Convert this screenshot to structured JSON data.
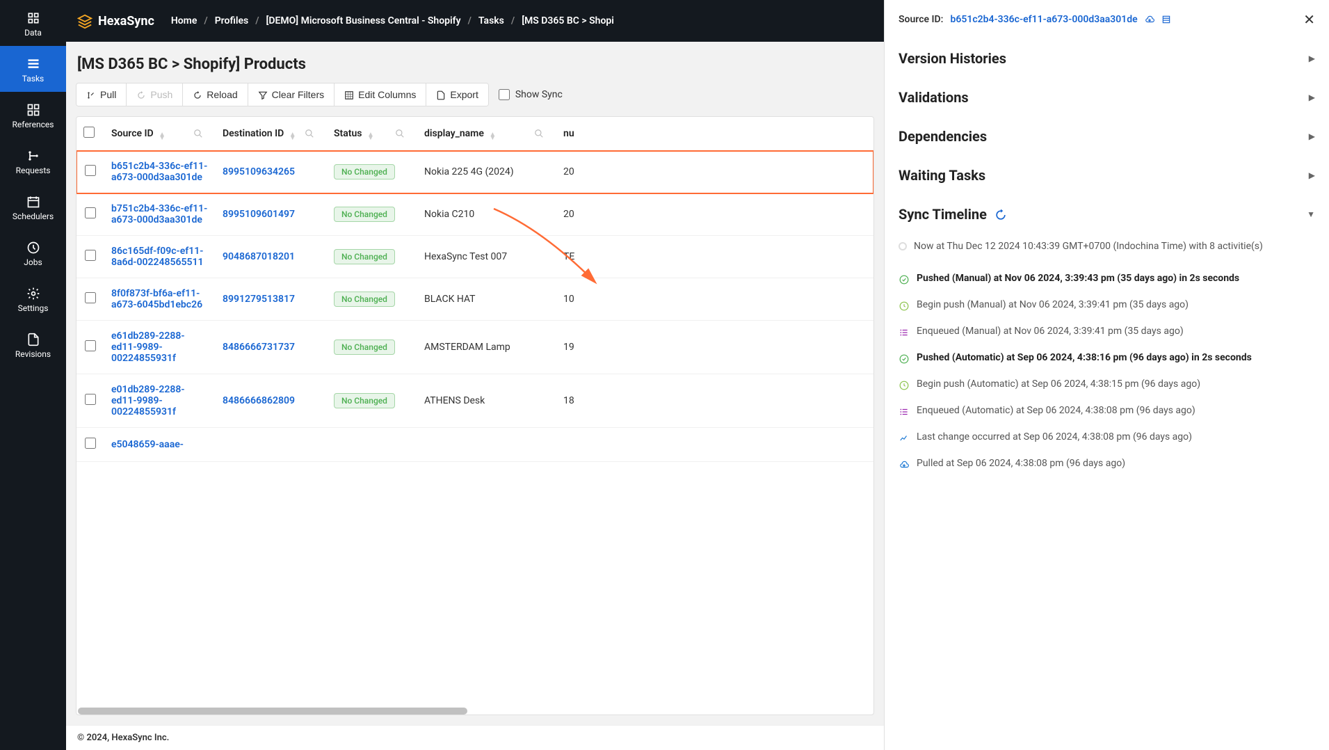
{
  "logo": "HexaSync",
  "breadcrumb": [
    "Home",
    "Profiles",
    "[DEMO] Microsoft Business Central - Shopify",
    "Tasks",
    "[MS D365 BC > Shopi"
  ],
  "sidebar": {
    "items": [
      {
        "label": "Data"
      },
      {
        "label": "Tasks"
      },
      {
        "label": "References"
      },
      {
        "label": "Requests"
      },
      {
        "label": "Schedulers"
      },
      {
        "label": "Jobs"
      },
      {
        "label": "Settings"
      },
      {
        "label": "Revisions"
      }
    ]
  },
  "page_title": "[MS D365 BC > Shopify] Products",
  "toolbar": {
    "pull": "Pull",
    "push": "Push",
    "reload": "Reload",
    "clear_filters": "Clear Filters",
    "edit_columns": "Edit Columns",
    "export": "Export",
    "show_sync": "Show Sync"
  },
  "columns": {
    "source_id": "Source ID",
    "destination_id": "Destination ID",
    "status": "Status",
    "display_name": "display_name",
    "nu": "nu"
  },
  "rows": [
    {
      "source_id": "b651c2b4-336c-ef11-a673-000d3aa301de",
      "destination_id": "8995109634265",
      "status": "No Changed",
      "display_name": "Nokia 225 4G (2024)",
      "nu": "20",
      "highlighted": true
    },
    {
      "source_id": "b751c2b4-336c-ef11-a673-000d3aa301de",
      "destination_id": "8995109601497",
      "status": "No Changed",
      "display_name": "Nokia C210",
      "nu": "20"
    },
    {
      "source_id": "86c165df-f09c-ef11-8a6d-002248565511",
      "destination_id": "9048687018201",
      "status": "No Changed",
      "display_name": "HexaSync Test 007",
      "nu": "TE"
    },
    {
      "source_id": "8f0f873f-bf6a-ef11-a673-6045bd1ebc26",
      "destination_id": "8991279513817",
      "status": "No Changed",
      "display_name": "BLACK HAT",
      "nu": "10"
    },
    {
      "source_id": "e61db289-2288-ed11-9989-00224855931f",
      "destination_id": "8486666731737",
      "status": "No Changed",
      "display_name": "AMSTERDAM Lamp",
      "nu": "19"
    },
    {
      "source_id": "e01db289-2288-ed11-9989-00224855931f",
      "destination_id": "8486666862809",
      "status": "No Changed",
      "display_name": "ATHENS Desk",
      "nu": "18"
    },
    {
      "source_id": "e5048659-aaae-",
      "destination_id": "",
      "status": "",
      "display_name": "",
      "nu": ""
    }
  ],
  "footer": "© 2024, HexaSync Inc.",
  "panel": {
    "source_id_label": "Source ID:",
    "source_id": "b651c2b4-336c-ef11-a673-000d3aa301de",
    "sections": {
      "version_histories": "Version Histories",
      "validations": "Validations",
      "dependencies": "Dependencies",
      "waiting_tasks": "Waiting Tasks",
      "sync_timeline": "Sync Timeline"
    },
    "timeline_now": "Now at Thu Dec 12 2024 10:43:39 GMT+0700 (Indochina Time) with 8 activitie(s)",
    "timeline": [
      {
        "type": "success",
        "text": "Pushed (Manual) at Nov 06 2024, 3:39:43 pm (35 days ago)  in 2s seconds",
        "bold": true
      },
      {
        "type": "clock",
        "text": "Begin push (Manual) at Nov 06 2024, 3:39:41 pm (35 days ago)"
      },
      {
        "type": "queue",
        "text": "Enqueued (Manual) at Nov 06 2024, 3:39:41 pm (35 days ago)"
      },
      {
        "type": "success",
        "text": "Pushed (Automatic) at Sep 06 2024, 4:38:16 pm (96 days ago)  in 2s seconds",
        "bold": true
      },
      {
        "type": "clock",
        "text": "Begin push (Automatic) at Sep 06 2024, 4:38:15 pm (96 days ago)"
      },
      {
        "type": "queue",
        "text": "Enqueued (Automatic) at Sep 06 2024, 4:38:08 pm (96 days ago)"
      },
      {
        "type": "chart",
        "text": "Last change occurred at Sep 06 2024, 4:38:08 pm (96 days ago)"
      },
      {
        "type": "cloud",
        "text": "Pulled at Sep 06 2024, 4:38:08 pm (96 days ago)"
      }
    ]
  }
}
